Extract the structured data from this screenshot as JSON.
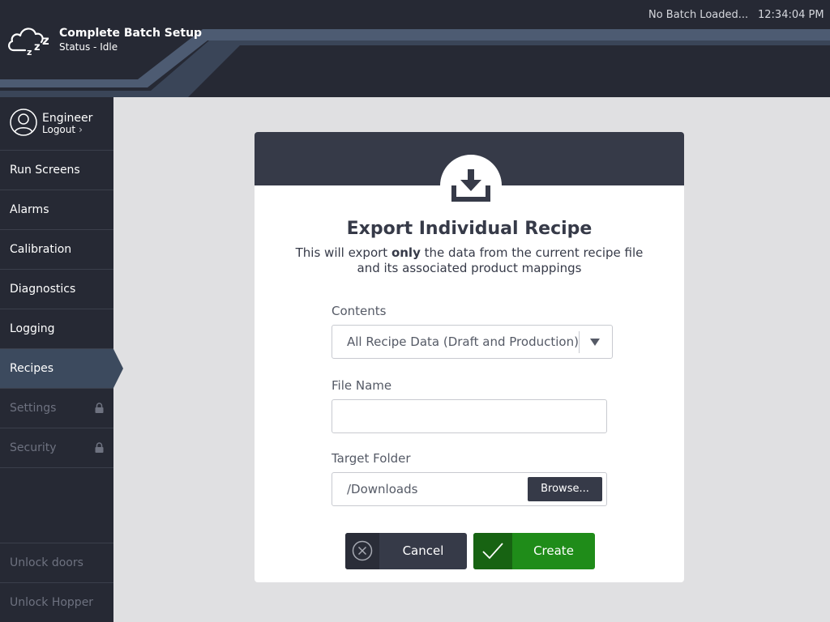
{
  "header": {
    "title": "Complete Batch Setup",
    "status": "Status - Idle",
    "batch_status": "No Batch Loaded...",
    "time": "12:34:04 PM",
    "app_icon": "sleeping-cloud-icon"
  },
  "user": {
    "name": "Engineer",
    "logout_label": "Logout",
    "avatar_icon": "user-avatar-icon"
  },
  "sidebar": {
    "items": [
      {
        "label": "Run Screens",
        "active": false,
        "locked": false
      },
      {
        "label": "Alarms",
        "active": false,
        "locked": false
      },
      {
        "label": "Calibration",
        "active": false,
        "locked": false
      },
      {
        "label": "Diagnostics",
        "active": false,
        "locked": false
      },
      {
        "label": "Logging",
        "active": false,
        "locked": false
      },
      {
        "label": "Recipes",
        "active": true,
        "locked": false
      },
      {
        "label": "Settings",
        "active": false,
        "locked": true
      },
      {
        "label": "Security",
        "active": false,
        "locked": true
      }
    ],
    "bottom_items": [
      {
        "label": "Unlock doors"
      },
      {
        "label": "Unlock Hopper"
      }
    ]
  },
  "dialog": {
    "icon": "download-icon",
    "title": "Export Individual Recipe",
    "description_before": "This will export ",
    "description_bold": "only",
    "description_after": " the data from the current recipe file and its associated product mappings",
    "contents_label": "Contents",
    "contents_value": "All Recipe Data (Draft and Production)",
    "file_name_label": "File Name",
    "file_name_value": "",
    "target_folder_label": "Target Folder",
    "target_folder_value": "/Downloads",
    "browse_label": "Browse...",
    "cancel_label": "Cancel",
    "create_label": "Create"
  },
  "colors": {
    "header_bg": "#262934",
    "accent_band": "#4d5b72",
    "active_nav": "#3c4a5e",
    "create_green": "#1f8c19",
    "cancel_dark": "#363a48"
  }
}
